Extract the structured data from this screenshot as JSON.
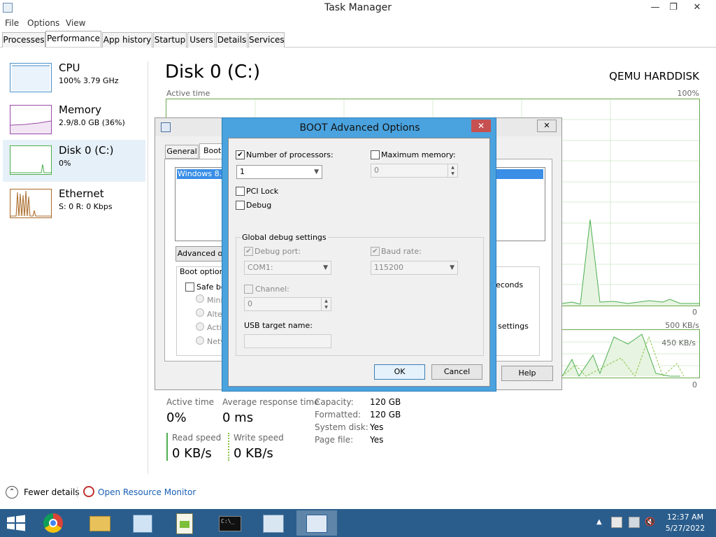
{
  "window": {
    "title": "Task Manager",
    "minimize": "—",
    "restore": "❐",
    "close": "✕"
  },
  "menu": [
    "File",
    "Options",
    "View"
  ],
  "tabs": [
    "Processes",
    "Performance",
    "App history",
    "Startup",
    "Users",
    "Details",
    "Services"
  ],
  "sidebar": [
    {
      "title": "CPU",
      "sub": "100% 3.79 GHz"
    },
    {
      "title": "Memory",
      "sub": "2.9/8.0 GB (36%)"
    },
    {
      "title": "Disk 0 (C:)",
      "sub": "0%"
    },
    {
      "title": "Ethernet",
      "sub": "S: 0 R: 0 Kbps"
    }
  ],
  "main": {
    "title": "Disk 0 (C:)",
    "model": "QEMU HARDDISK",
    "active_time_label": "Active time",
    "active_max": "100%",
    "active_min": "0",
    "transfer_max": "500 KB/s",
    "transfer_mid": "450 KB/s",
    "transfer_min": "0",
    "stats": {
      "active_time_label": "Active time",
      "active_time": "0%",
      "avg_resp_label": "Average response time",
      "avg_resp": "0 ms",
      "read_label": "Read speed",
      "read": "0 KB/s",
      "write_label": "Write speed",
      "write": "0 KB/s",
      "capacity_label": "Capacity:",
      "capacity": "120 GB",
      "formatted_label": "Formatted:",
      "formatted": "120 GB",
      "system_disk_label": "System disk:",
      "system_disk": "Yes",
      "page_file_label": "Page file:",
      "page_file": "Yes"
    }
  },
  "bottom": {
    "fewer": "Fewer details",
    "resmon": "Open Resource Monitor"
  },
  "props": {
    "tabs": [
      "General",
      "Boot"
    ],
    "os_entry": "Windows 8.1",
    "advanced_btn": "Advanced o",
    "boot_options": "Boot options",
    "safe_boot": "Safe bo",
    "radios": [
      "Minir",
      "Alter",
      "Activ",
      "Netv"
    ],
    "seconds": "econds",
    "settings": "settings",
    "help": "Help"
  },
  "boa": {
    "title": "BOOT Advanced Options",
    "num_proc_label": "Number of processors:",
    "num_proc_value": "1",
    "max_mem_label": "Maximum memory:",
    "max_mem_value": "0",
    "pci_lock": "PCI Lock",
    "debug": "Debug",
    "global_debug": "Global debug settings",
    "debug_port_label": "Debug port:",
    "debug_port_value": "COM1:",
    "baud_rate_label": "Baud rate:",
    "baud_rate_value": "115200",
    "channel_label": "Channel:",
    "channel_value": "0",
    "usb_target_label": "USB target name:",
    "ok": "OK",
    "cancel": "Cancel"
  },
  "taskbar": {
    "time": "12:37 AM",
    "date": "5/27/2022"
  },
  "colors": {
    "disk_green": "#4caf50",
    "taskbar": "#2a5d8c",
    "dialog_frame": "#4aa3df",
    "close_red": "#c75050"
  }
}
